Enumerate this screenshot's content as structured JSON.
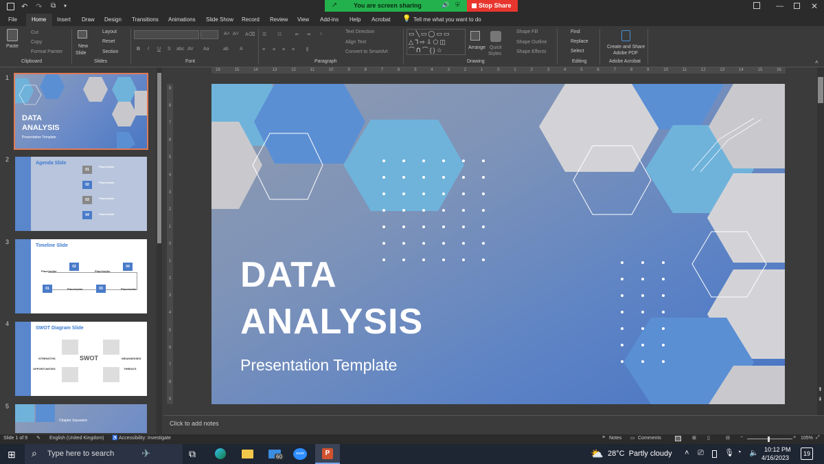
{
  "share": {
    "sharing_label": "You are screen sharing",
    "stop_label": "Stop Share"
  },
  "tabs": [
    "File",
    "Home",
    "Insert",
    "Draw",
    "Design",
    "Transitions",
    "Animations",
    "Slide Show",
    "Record",
    "Review",
    "View",
    "Add-ins",
    "Help",
    "Acrobat"
  ],
  "tell_me": "Tell me what you want to do",
  "ribbon": {
    "clipboard": {
      "paste": "Paste",
      "cut": "Cut",
      "copy": "Copy",
      "format_painter": "Format Painter",
      "group": "Clipboard"
    },
    "slides": {
      "new_slide": "New",
      "new_slide2": "Slide",
      "layout": "Layout",
      "reset": "Reset",
      "section": "Section",
      "group": "Slides"
    },
    "font": {
      "group": "Font"
    },
    "paragraph": {
      "text_direction": "Text Direction",
      "align_text": "Align Text",
      "smartart": "Convert to SmartArt",
      "group": "Paragraph"
    },
    "drawing": {
      "arrange": "Arrange",
      "quick_styles": "Quick",
      "quick_styles2": "Styles",
      "shape_fill": "Shape Fill",
      "shape_outline": "Shape Outline",
      "shape_effects": "Shape Effects",
      "group": "Drawing"
    },
    "editing": {
      "find": "Find",
      "replace": "Replace",
      "select": "Select",
      "group": "Editing"
    },
    "acrobat": {
      "create": "Create and Share",
      "create2": "Adobe PDF",
      "group": "Adobe Acrobat"
    }
  },
  "ruler_h": [
    "16",
    "15",
    "14",
    "13",
    "12",
    "11",
    "10",
    "9",
    "8",
    "7",
    "6",
    "5",
    "4",
    "3",
    "2",
    "1",
    "0",
    "1",
    "2",
    "3",
    "4",
    "5",
    "6",
    "7",
    "8",
    "9",
    "10",
    "11",
    "12",
    "13",
    "14",
    "15",
    "16"
  ],
  "ruler_v": [
    "9",
    "8",
    "7",
    "6",
    "5",
    "4",
    "3",
    "2",
    "1",
    "0",
    "1",
    "2",
    "3",
    "4",
    "5",
    "6",
    "7",
    "8",
    "9"
  ],
  "thumbnails": [
    {
      "num": "1",
      "title": "DATA",
      "title2": "ANALYSIS",
      "sub": "Presentation Template"
    },
    {
      "num": "2",
      "title": "Agenda Slide",
      "items": [
        "01",
        "02",
        "03",
        "04"
      ],
      "ph": "Placeholder"
    },
    {
      "num": "3",
      "title": "Timeline Slide",
      "items": [
        "01",
        "02",
        "03",
        "04"
      ],
      "ph": "Placeholder"
    },
    {
      "num": "4",
      "title": "SWOT Diagram Slide",
      "center": "SWOT",
      "labels": [
        "STRENGTHS",
        "WEAKNESSES",
        "OPPORTUNITIES",
        "THREATS"
      ]
    },
    {
      "num": "5",
      "title": "Chapter Separator"
    }
  ],
  "slide": {
    "title1": "DATA",
    "title2": "ANALYSIS",
    "subtitle": "Presentation Template"
  },
  "notes": "Click to add notes",
  "status": {
    "slide": "Slide 1 of 9",
    "language": "English (United Kingdom)",
    "accessibility": "Accessibility: Investigate",
    "notes": "Notes",
    "comments": "Comments",
    "zoom": "105%"
  },
  "taskbar": {
    "search": "Type here to search",
    "mail_badge": "60",
    "weather": "28°C  Partly cloudy",
    "time": "10:12 PM",
    "date": "4/16/2023",
    "notif": "19",
    "zoom_label": "zoom"
  }
}
